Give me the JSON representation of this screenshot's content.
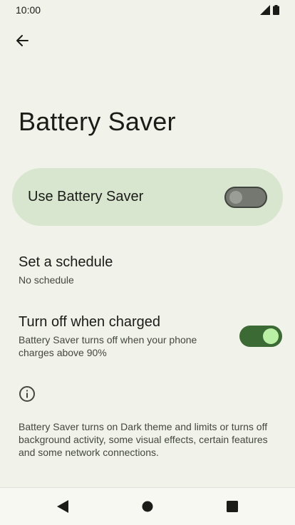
{
  "status_bar": {
    "time": "10:00"
  },
  "page": {
    "title": "Battery Saver"
  },
  "main_toggle": {
    "label": "Use Battery Saver",
    "state": "off"
  },
  "schedule": {
    "title": "Set a schedule",
    "subtitle": "No schedule"
  },
  "turn_off_charged": {
    "title": "Turn off when charged",
    "subtitle": "Battery Saver turns off when your phone charges above 90%",
    "state": "on"
  },
  "footer": {
    "text": "Battery Saver turns on Dark theme and limits or turns off background activity, some visual effects, certain features and some network connections."
  },
  "icons": [
    "back-arrow-icon",
    "signal-icon",
    "battery-icon",
    "info-icon",
    "nav-back-icon",
    "nav-home-icon",
    "nav-recents-icon"
  ],
  "colors": {
    "background": "#f1f2ea",
    "card": "#d8e6cf",
    "switch_on_track": "#3c6a35",
    "switch_on_knob": "#baf0a6"
  }
}
